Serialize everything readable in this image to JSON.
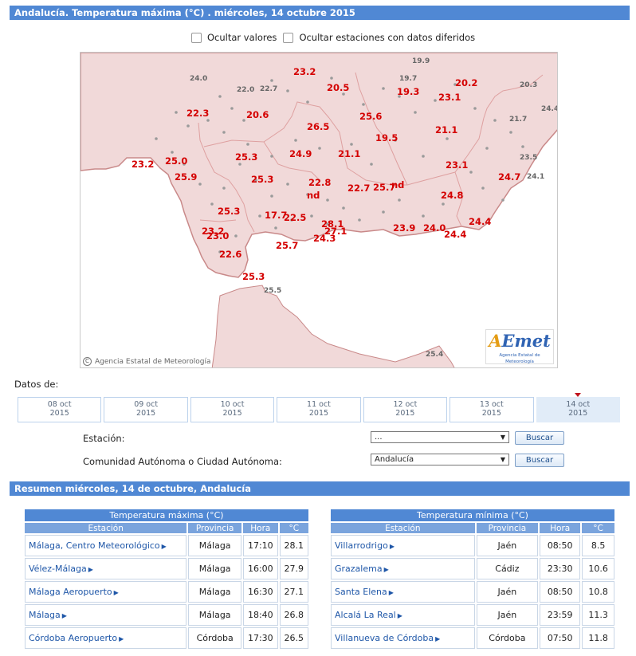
{
  "header": {
    "title": "Andalucía. Temperatura máxima (°C) . miércoles, 14 octubre 2015"
  },
  "options": {
    "hide_values": "Ocultar valores",
    "hide_deferred": "Ocultar estaciones con datos diferidos"
  },
  "map": {
    "copyright": "Agencia Estatal de Meteorología",
    "logo_text": "AEmet",
    "logo_sub": "Agencia Estatal de Meteorología",
    "colors": {
      "value": "#d40000",
      "grey_value": "#666666",
      "sea": "#ffffff",
      "land": "#f1d9d9"
    },
    "red_values": [
      "23.2",
      "20.5",
      "20.2",
      "19.3",
      "23.1",
      "22.3",
      "20.6",
      "26.5",
      "25.6",
      "21.1",
      "19.5",
      "23.2",
      "25.0",
      "25.3",
      "24.9",
      "21.1",
      "23.1",
      "25.9",
      "25.3",
      "22.8",
      "22.7",
      "25.7",
      "nd",
      "24.7",
      "nd",
      "24.8",
      "25.3",
      "17.7",
      "22.5",
      "28.1",
      "24.4",
      "23.2",
      "27.1",
      "23.9",
      "24.0",
      "23.0",
      "24.3",
      "24.4",
      "25.7",
      "22.6",
      "25.3"
    ],
    "grey_values": [
      "19.9",
      "24.0",
      "22.0",
      "22.7",
      "19.7",
      "20.3",
      "24.4",
      "21.7",
      "23.5",
      "24.1",
      "25.5",
      "25.4"
    ]
  },
  "dates": {
    "label": "Datos de:",
    "items": [
      {
        "day": "08 oct",
        "year": "2015"
      },
      {
        "day": "09 oct",
        "year": "2015"
      },
      {
        "day": "10 oct",
        "year": "2015"
      },
      {
        "day": "11 oct",
        "year": "2015"
      },
      {
        "day": "12 oct",
        "year": "2015"
      },
      {
        "day": "13 oct",
        "year": "2015"
      },
      {
        "day": "14 oct",
        "year": "2015"
      }
    ]
  },
  "form": {
    "station_label": "Estación:",
    "station_value": "...",
    "community_label": "Comunidad Autónoma o Ciudad Autónoma:",
    "community_value": "Andalucía",
    "search": "Buscar"
  },
  "summary": {
    "title": "Resumen miércoles, 14 de octubre, Andalucía"
  },
  "tmax": {
    "caption": "Temperatura máxima (°C)",
    "cols": [
      "Estación",
      "Provincia",
      "Hora",
      "°C"
    ],
    "rows": [
      [
        "Málaga, Centro Meteorológico",
        "Málaga",
        "17:10",
        "28.1"
      ],
      [
        "Vélez-Málaga",
        "Málaga",
        "16:00",
        "27.9"
      ],
      [
        "Málaga Aeropuerto",
        "Málaga",
        "16:30",
        "27.1"
      ],
      [
        "Málaga",
        "Málaga",
        "18:40",
        "26.8"
      ],
      [
        "Córdoba Aeropuerto",
        "Córdoba",
        "17:30",
        "26.5"
      ]
    ]
  },
  "tmin": {
    "caption": "Temperatura mínima (°C)",
    "cols": [
      "Estación",
      "Provincia",
      "Hora",
      "°C"
    ],
    "rows": [
      [
        "Villarrodrigo",
        "Jaén",
        "08:50",
        "8.5"
      ],
      [
        "Grazalema",
        "Cádiz",
        "23:30",
        "10.6"
      ],
      [
        "Santa Elena",
        "Jaén",
        "08:50",
        "10.8"
      ],
      [
        "Alcalá La Real",
        "Jaén",
        "23:59",
        "11.3"
      ],
      [
        "Villanueva de Córdoba",
        "Córdoba",
        "07:50",
        "11.8"
      ]
    ]
  }
}
